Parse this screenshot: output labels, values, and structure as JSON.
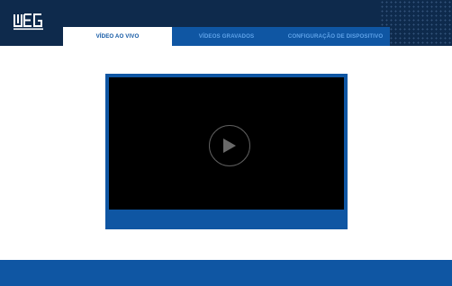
{
  "app": {
    "logo_text": "WEG"
  },
  "tabs": [
    {
      "label": "VÍDEO AO VIVO",
      "active": true
    },
    {
      "label": "VÍDEOS GRAVADOS",
      "active": false
    },
    {
      "label": "CONFIGURAÇÃO DE DISPOSITIVO",
      "active": false
    }
  ],
  "player": {
    "play_icon": "play-icon"
  },
  "colors": {
    "header_bg": "#0e2a4c",
    "brand_blue": "#0f56a3",
    "inactive_tab_text": "#5ea2e8",
    "video_bg": "#000000"
  }
}
